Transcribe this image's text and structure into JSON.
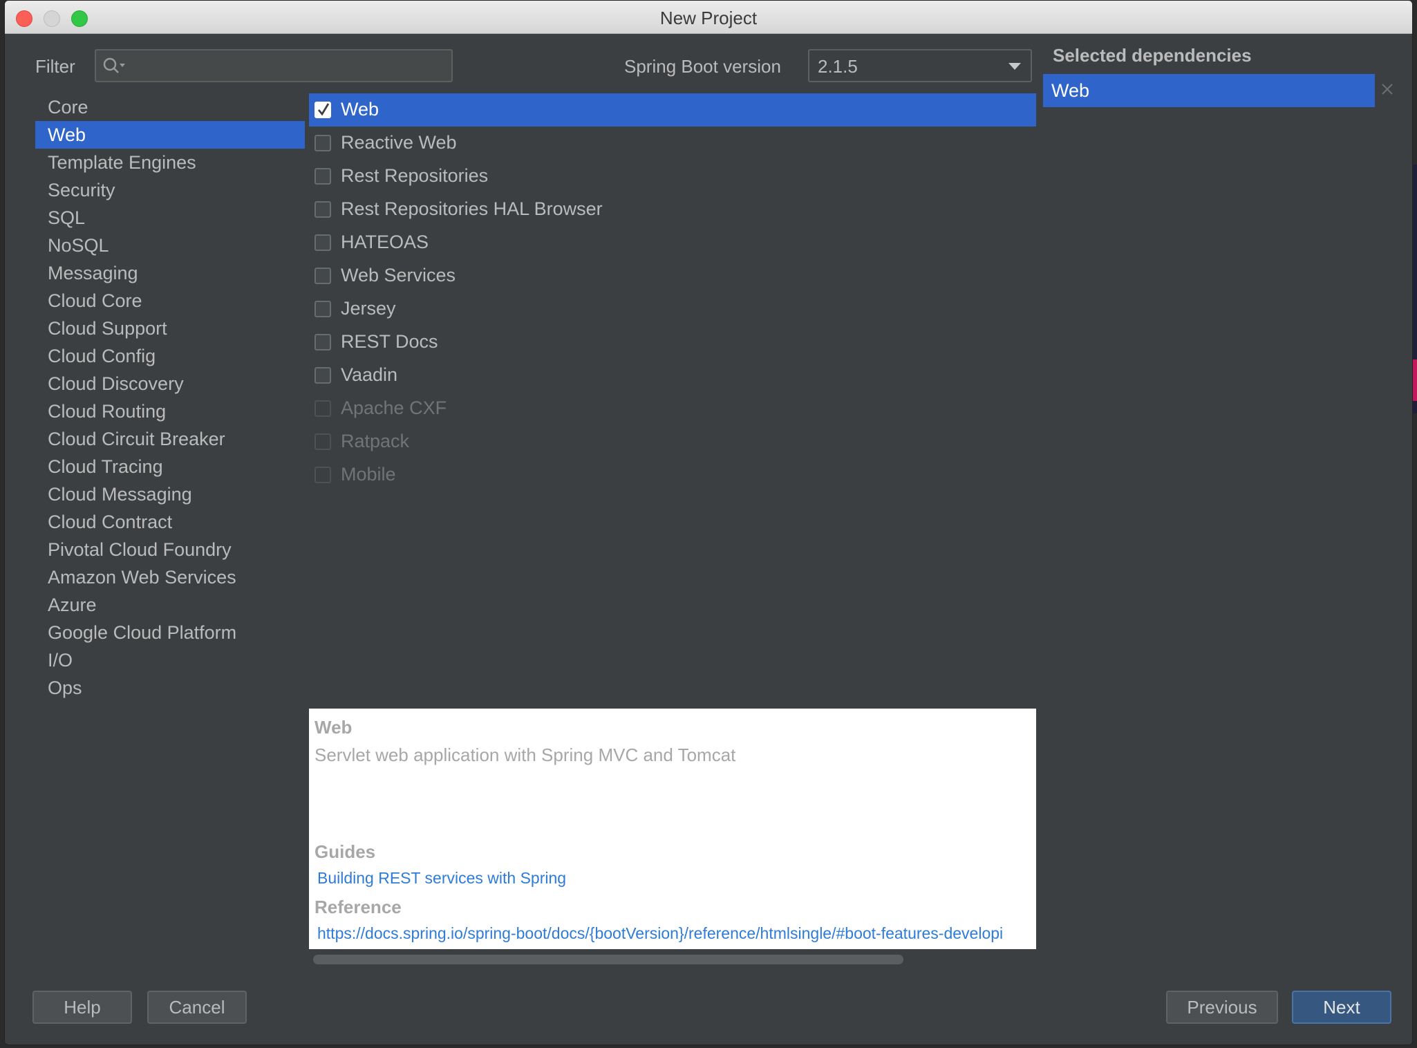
{
  "window": {
    "title": "New Project"
  },
  "filter": {
    "label": "Filter",
    "value": "",
    "placeholder": ""
  },
  "spring_boot": {
    "label": "Spring Boot version",
    "value": "2.1.5"
  },
  "categories": [
    {
      "label": "Core",
      "selected": false
    },
    {
      "label": "Web",
      "selected": true
    },
    {
      "label": "Template Engines",
      "selected": false
    },
    {
      "label": "Security",
      "selected": false
    },
    {
      "label": "SQL",
      "selected": false
    },
    {
      "label": "NoSQL",
      "selected": false
    },
    {
      "label": "Messaging",
      "selected": false
    },
    {
      "label": "Cloud Core",
      "selected": false
    },
    {
      "label": "Cloud Support",
      "selected": false
    },
    {
      "label": "Cloud Config",
      "selected": false
    },
    {
      "label": "Cloud Discovery",
      "selected": false
    },
    {
      "label": "Cloud Routing",
      "selected": false
    },
    {
      "label": "Cloud Circuit Breaker",
      "selected": false
    },
    {
      "label": "Cloud Tracing",
      "selected": false
    },
    {
      "label": "Cloud Messaging",
      "selected": false
    },
    {
      "label": "Cloud Contract",
      "selected": false
    },
    {
      "label": "Pivotal Cloud Foundry",
      "selected": false
    },
    {
      "label": "Amazon Web Services",
      "selected": false
    },
    {
      "label": "Azure",
      "selected": false
    },
    {
      "label": "Google Cloud Platform",
      "selected": false
    },
    {
      "label": "I/O",
      "selected": false
    },
    {
      "label": "Ops",
      "selected": false
    }
  ],
  "dependencies": [
    {
      "label": "Web",
      "checked": true,
      "enabled": true,
      "selected": true
    },
    {
      "label": "Reactive Web",
      "checked": false,
      "enabled": true,
      "selected": false
    },
    {
      "label": "Rest Repositories",
      "checked": false,
      "enabled": true,
      "selected": false
    },
    {
      "label": "Rest Repositories HAL Browser",
      "checked": false,
      "enabled": true,
      "selected": false
    },
    {
      "label": "HATEOAS",
      "checked": false,
      "enabled": true,
      "selected": false
    },
    {
      "label": "Web Services",
      "checked": false,
      "enabled": true,
      "selected": false
    },
    {
      "label": "Jersey",
      "checked": false,
      "enabled": true,
      "selected": false
    },
    {
      "label": "REST Docs",
      "checked": false,
      "enabled": true,
      "selected": false
    },
    {
      "label": "Vaadin",
      "checked": false,
      "enabled": true,
      "selected": false
    },
    {
      "label": "Apache CXF",
      "checked": false,
      "enabled": false,
      "selected": false
    },
    {
      "label": "Ratpack",
      "checked": false,
      "enabled": false,
      "selected": false
    },
    {
      "label": "Mobile",
      "checked": false,
      "enabled": false,
      "selected": false
    }
  ],
  "description": {
    "title": "Web",
    "text": "Servlet web application with Spring MVC and Tomcat",
    "guides_label": "Guides",
    "guide_link": "Building REST services with Spring",
    "reference_label": "Reference",
    "reference_link": "https://docs.spring.io/spring-boot/docs/{bootVersion}/reference/htmlsingle/#boot-features-developi"
  },
  "selected_dependencies": {
    "title": "Selected dependencies",
    "items": [
      "Web"
    ]
  },
  "buttons": {
    "help": "Help",
    "cancel": "Cancel",
    "previous": "Previous",
    "next": "Next"
  },
  "icons": {
    "search": "search-icon",
    "check": "check-icon",
    "remove": "close-icon",
    "dropdown": "chevron-down-icon"
  },
  "colors": {
    "selection": "#2f65ca",
    "link": "#2f7bd8",
    "background": "#3c3f41"
  }
}
